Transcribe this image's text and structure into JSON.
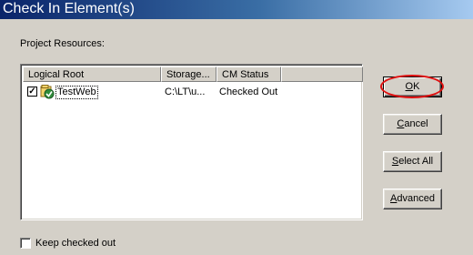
{
  "window": {
    "title": "Check In Element(s)"
  },
  "section_label": "Project Resources:",
  "table": {
    "columns": [
      "Logical Root",
      "Storage...",
      "CM Status",
      ""
    ],
    "rows": [
      {
        "checked": true,
        "icon": "web-project-icon",
        "logical_root": "TestWeb",
        "storage": "C:\\LT\\u...",
        "cm_status": "Checked Out"
      }
    ]
  },
  "buttons": {
    "ok": {
      "mnemonic": "O",
      "rest": "K"
    },
    "cancel": {
      "mnemonic": "C",
      "rest": "ancel"
    },
    "select_all": {
      "pre": "",
      "mnemonic": "S",
      "rest": "elect All"
    },
    "advanced": {
      "mnemonic": "A",
      "rest": "dvanced"
    }
  },
  "annotation": {
    "color": "#e01010"
  },
  "keep_checked_out": {
    "label": "Keep checked out",
    "checked": false
  }
}
